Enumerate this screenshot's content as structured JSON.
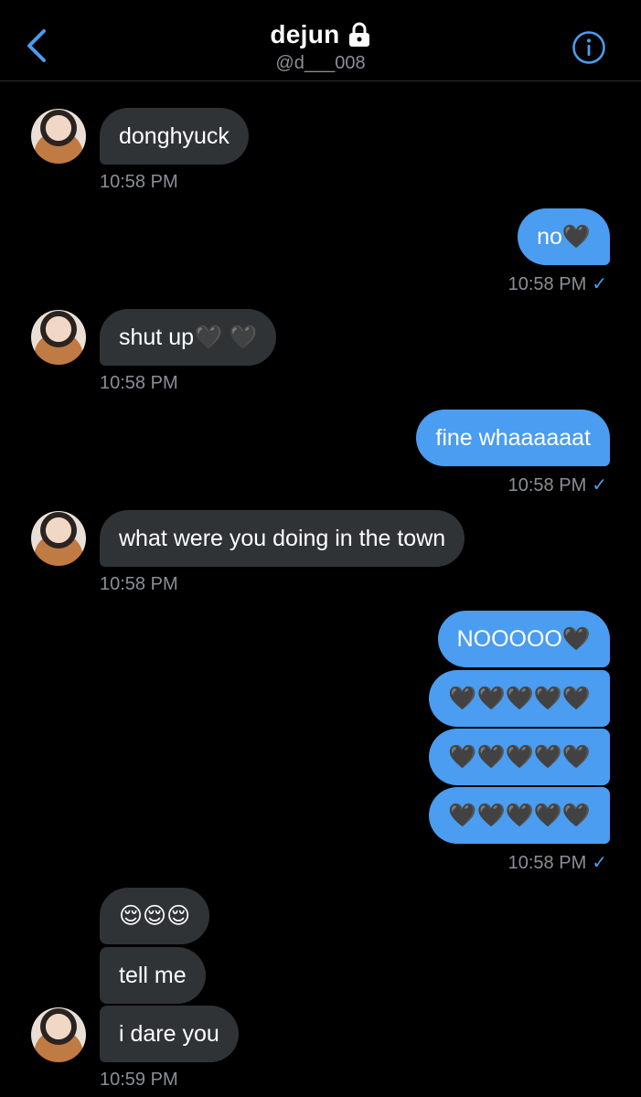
{
  "header": {
    "name": "dejun",
    "handle": "@d___008"
  },
  "messages": [
    {
      "text": "donghyuck",
      "time": "10:58 PM"
    },
    {
      "text": "no🖤",
      "time": "10:58 PM"
    },
    {
      "text": "shut up🖤 🖤",
      "time": "10:58 PM"
    },
    {
      "text": "fine whaaaaaat",
      "time": "10:58 PM"
    },
    {
      "text": "what were you doing in the town",
      "time": "10:58 PM"
    },
    {
      "text": "NOOOOO🖤",
      "group": "out"
    },
    {
      "text": "🖤🖤🖤🖤🖤"
    },
    {
      "text": "🖤🖤🖤🖤🖤"
    },
    {
      "text": "🖤🖤🖤🖤🖤",
      "time": "10:58 PM"
    },
    {
      "text": "😌😌😌"
    },
    {
      "text": "tell me"
    },
    {
      "text": "i dare you",
      "time": "10:59 PM"
    }
  ],
  "read_check": "✓",
  "colors": {
    "accent": "#4a9df0",
    "incoming_bubble": "#2f3336",
    "background": "#000000"
  },
  "icons": {
    "back": "chevron-left-icon",
    "lock": "lock-icon",
    "info": "info-icon"
  }
}
